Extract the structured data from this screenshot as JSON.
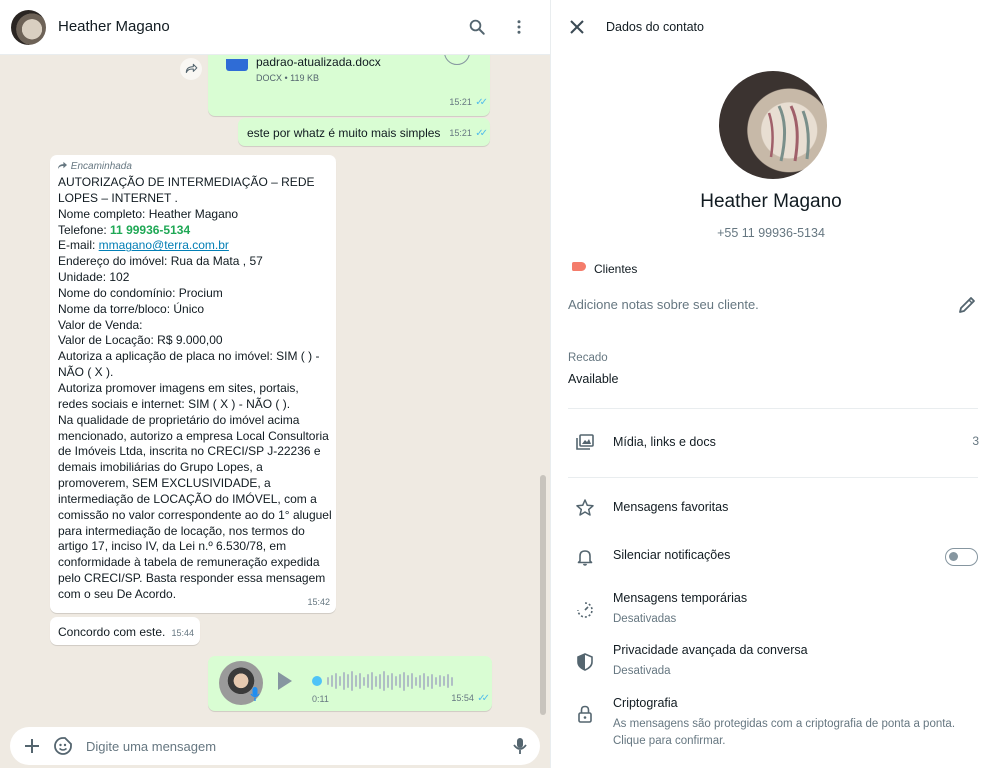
{
  "chat": {
    "header": {
      "contact_name": "Heather Magano"
    },
    "doc_message": {
      "file_name": "padrao-atualizada.docx",
      "meta": "DOCX • 119 KB",
      "time": "15:21"
    },
    "text_message": {
      "text": "este por whatz é muito mais simples",
      "time": "15:21"
    },
    "forwarded_message": {
      "forwarded_label": "Encaminhada",
      "lines": [
        "AUTORIZAÇÃO DE INTERMEDIAÇÃO – REDE",
        "LOPES – INTERNET .",
        "Nome completo: Heather Magano"
      ],
      "phone_prefix": "Telefone: ",
      "phone": "11 99936-5134",
      "email_prefix": "E-mail: ",
      "email": "mmagano@terra.com.br",
      "lines_after": [
        "Endereço do imóvel: Rua da Mata , 57",
        "Unidade: 102",
        "Nome do condomínio: Procium",
        "Nome da torre/bloco: Único",
        "Valor de Venda:",
        "Valor de Locação: R$ 9.000,00",
        "Autoriza a aplicação de placa no imóvel: SIM (   ) -",
        "NÃO ( X ).",
        "Autoriza promover imagens em sites, portais,",
        "redes sociais e internet: SIM ( X  ) - NÃO (    ).",
        "Na qualidade de proprietário do imóvel acima",
        "mencionado, autorizo a empresa Local Consultoria",
        "de Imóveis Ltda, inscrita no CRECI/SP J-22236 e",
        "demais imobiliárias do Grupo Lopes, a",
        "promoverem, SEM EXCLUSIVIDADE, a",
        "intermediação de LOCAÇÃO do IMÓVEL, com a",
        "comissão no valor correspondente ao do 1° aluguel",
        "para intermediação de locação, nos termos do",
        "artigo 17, inciso IV, da Lei n.º 6.530/78, em",
        "conformidade à tabela de remuneração expedida",
        "pelo CRECI/SP. Basta responder essa mensagem",
        "com o seu De Acordo."
      ],
      "time": "15:42"
    },
    "reply_message": {
      "text": "Concordo com este.",
      "time": "15:44"
    },
    "audio_message": {
      "duration": "0:11",
      "time": "15:54"
    },
    "composer": {
      "placeholder": "Digite uma mensagem"
    }
  },
  "contact_info": {
    "title": "Dados do contato",
    "name": "Heather Magano",
    "phone": "+55 11 99936-5134",
    "label": "Clientes",
    "notes_placeholder": "Adicione notas sobre seu cliente.",
    "status_label": "Recado",
    "status_value": "Available",
    "media": {
      "label": "Mídia, links e docs",
      "count": "3"
    },
    "starred": {
      "label": "Mensagens favoritas"
    },
    "mute": {
      "label": "Silenciar notificações",
      "enabled": false
    },
    "disappearing": {
      "label": "Mensagens temporárias",
      "sub": "Desativadas"
    },
    "privacy": {
      "label": "Privacidade avançada da conversa",
      "sub": "Desativada"
    },
    "encryption": {
      "label": "Criptografia",
      "sub": "As mensagens são protegidas com a criptografia de ponta a ponta. Clique para confirmar."
    }
  },
  "colors": {
    "outgoing_bubble": "#d9fdd3",
    "incoming_bubble": "#ffffff",
    "chat_bg": "#efeae2",
    "read_ticks": "#53bdeb",
    "phone_link": "#1fa855",
    "label_tag": "#f47c6b"
  },
  "icons": [
    "search-icon",
    "menu-dots-icon",
    "forward-icon",
    "document-icon",
    "plus-icon",
    "sticker-icon",
    "mic-icon",
    "close-icon",
    "pencil-icon",
    "media-icon",
    "star-icon",
    "bell-icon",
    "timer-icon",
    "shield-icon",
    "lock-icon",
    "label-icon"
  ]
}
